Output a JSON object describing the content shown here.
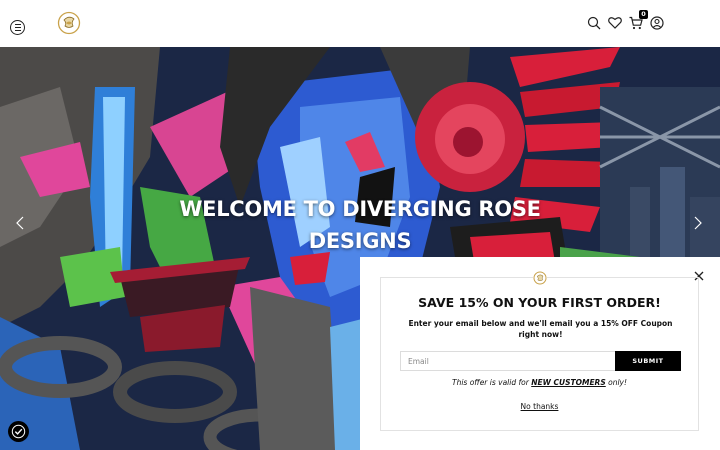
{
  "header": {
    "menu_icon": "hamburger-menu-icon",
    "logo_icon": "diverging-rose-logo-icon",
    "icons": [
      "search-icon",
      "heart-icon",
      "cart-icon",
      "account-icon"
    ],
    "cart_count": "0"
  },
  "hero": {
    "title": "WELCOME TO DIVERGING ROSE DESIGNS",
    "prev_icon": "chevron-left-icon",
    "next_icon": "chevron-right-icon"
  },
  "accessibility": {
    "icon": "accessibility-icon"
  },
  "popup": {
    "title": "SAVE 15% ON YOUR FIRST ORDER!",
    "subtitle": "Enter your email below and we'll email you a 15% OFF Coupon right now!",
    "email_placeholder": "Email",
    "submit_label": "SUBMIT",
    "note_prefix": "This offer is valid for ",
    "note_emphasis": "NEW CUSTOMERS",
    "note_suffix": " only!",
    "decline_label": "No thanks",
    "close_icon": "close-icon"
  },
  "colors": {
    "accent": "#000000",
    "logo_gold": "#c9a24a",
    "hero_pink": "#e0479b",
    "hero_blue": "#2f6fd6",
    "hero_red": "#d81f3a"
  }
}
